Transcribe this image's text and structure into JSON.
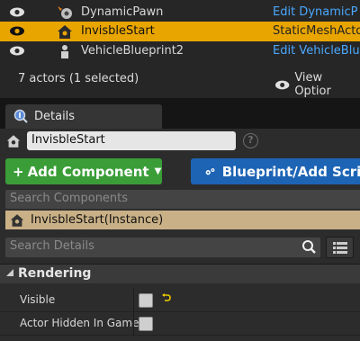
{
  "outliner": {
    "rows": [
      {
        "name": "DynamicPawn",
        "type": "Edit DynamicP",
        "type_kind": "link",
        "selected": false
      },
      {
        "name": "InvisbleStart",
        "type": "StaticMeshActo",
        "type_kind": "text",
        "selected": true
      },
      {
        "name": "VehicleBlueprint2",
        "type": "Edit VehicleBlu",
        "type_kind": "link",
        "selected": false
      }
    ],
    "status": "7 actors (1 selected)",
    "view_options_label": "View Optior"
  },
  "details": {
    "tab_label": "Details",
    "actor_name": "InvisbleStart",
    "add_component_label": "Add Component",
    "blueprint_label": "Blueprint/Add Scrip",
    "search_components_placeholder": "Search Components",
    "instance_label": "InvisbleStart(Instance)",
    "search_details_placeholder": "Search Details",
    "category": "Rendering",
    "properties": [
      {
        "label": "Visible",
        "checked": false,
        "has_reset": true
      },
      {
        "label": "Actor Hidden In Game",
        "checked": false,
        "has_reset": false
      }
    ]
  },
  "colors": {
    "selected_row": "#e8a500",
    "link": "#4aa8ff",
    "add_component": "#3a9d38",
    "blueprint": "#1d64b5",
    "instance_row": "#c9b086"
  }
}
